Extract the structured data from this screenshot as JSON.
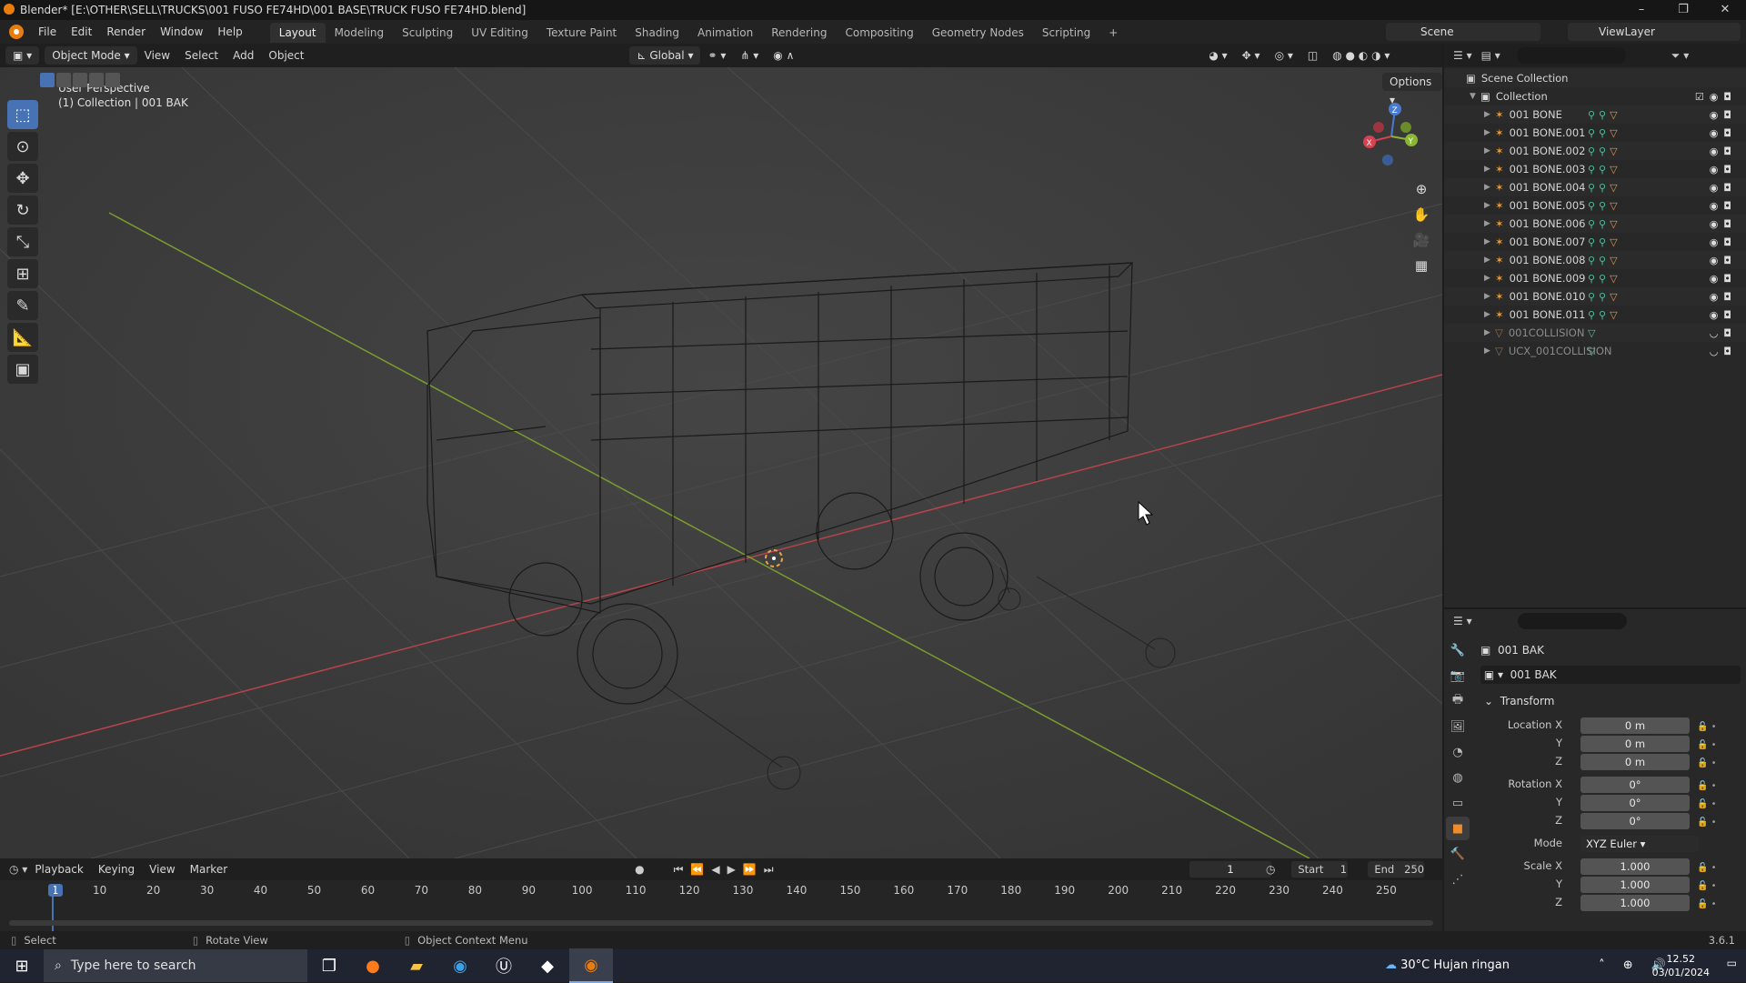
{
  "window": {
    "title": "Blender* [E:\\OTHER\\SELL\\TRUCKS\\001 FUSO FE74HD\\001 BASE\\TRUCK FUSO FE74HD.blend]"
  },
  "menu": [
    "File",
    "Edit",
    "Render",
    "Window",
    "Help"
  ],
  "workspaces": [
    "Layout",
    "Modeling",
    "Sculpting",
    "UV Editing",
    "Texture Paint",
    "Shading",
    "Animation",
    "Rendering",
    "Compositing",
    "Geometry Nodes",
    "Scripting"
  ],
  "scene": {
    "name": "Scene",
    "view_layer": "ViewLayer"
  },
  "viewport_header": {
    "mode": "Object Mode",
    "menus": [
      "View",
      "Select",
      "Add",
      "Object"
    ],
    "orientation": "Global",
    "options": "Options"
  },
  "viewport": {
    "perspective": "User Perspective",
    "context": "(1) Collection | 001 BAK"
  },
  "toolbar": [
    "select-box",
    "cursor",
    "move",
    "rotate",
    "scale",
    "transform",
    "annotate",
    "measure",
    "add-cube"
  ],
  "outliner": {
    "root": "Scene Collection",
    "collection": "Collection",
    "items": [
      {
        "name": "001 BONE",
        "dim": false
      },
      {
        "name": "001 BONE.001",
        "dim": false
      },
      {
        "name": "001 BONE.002",
        "dim": false
      },
      {
        "name": "001 BONE.003",
        "dim": false
      },
      {
        "name": "001 BONE.004",
        "dim": false
      },
      {
        "name": "001 BONE.005",
        "dim": false
      },
      {
        "name": "001 BONE.006",
        "dim": false
      },
      {
        "name": "001 BONE.007",
        "dim": false
      },
      {
        "name": "001 BONE.008",
        "dim": false
      },
      {
        "name": "001 BONE.009",
        "dim": false
      },
      {
        "name": "001 BONE.010",
        "dim": false
      },
      {
        "name": "001 BONE.011",
        "dim": false
      },
      {
        "name": "001COLLISION",
        "dim": true
      },
      {
        "name": "UCX_001COLLISION",
        "dim": true
      }
    ]
  },
  "properties": {
    "object_name": "001 BAK",
    "data_name": "001 BAK",
    "panel": "Transform",
    "location": {
      "label": "Location X",
      "x": "0 m",
      "y": "0 m",
      "z": "0 m"
    },
    "rotation": {
      "label": "Rotation X",
      "x": "0°",
      "y": "0°",
      "z": "0°"
    },
    "mode_label": "Mode",
    "mode": "XYZ Euler",
    "scale": {
      "label": "Scale X",
      "x": "1.000",
      "y": "1.000",
      "z": "1.000"
    },
    "axis_y": "Y",
    "axis_z": "Z"
  },
  "timeline": {
    "menus": [
      "Playback",
      "Keying",
      "View",
      "Marker"
    ],
    "current_frame": "1",
    "start_label": "Start",
    "start": "1",
    "end_label": "End",
    "end": "250",
    "ruler": [
      "1",
      "10",
      "20",
      "30",
      "40",
      "50",
      "60",
      "70",
      "80",
      "90",
      "100",
      "110",
      "120",
      "130",
      "140",
      "150",
      "160",
      "170",
      "180",
      "190",
      "200",
      "210",
      "220",
      "230",
      "240",
      "250"
    ]
  },
  "status": {
    "select": "Select",
    "rotate": "Rotate View",
    "context": "Object Context Menu",
    "version": "3.6.1"
  },
  "taskbar": {
    "search": "Type here to search",
    "weather": "30°C  Hujan ringan",
    "time": "12.52",
    "date": "03/01/2024"
  }
}
